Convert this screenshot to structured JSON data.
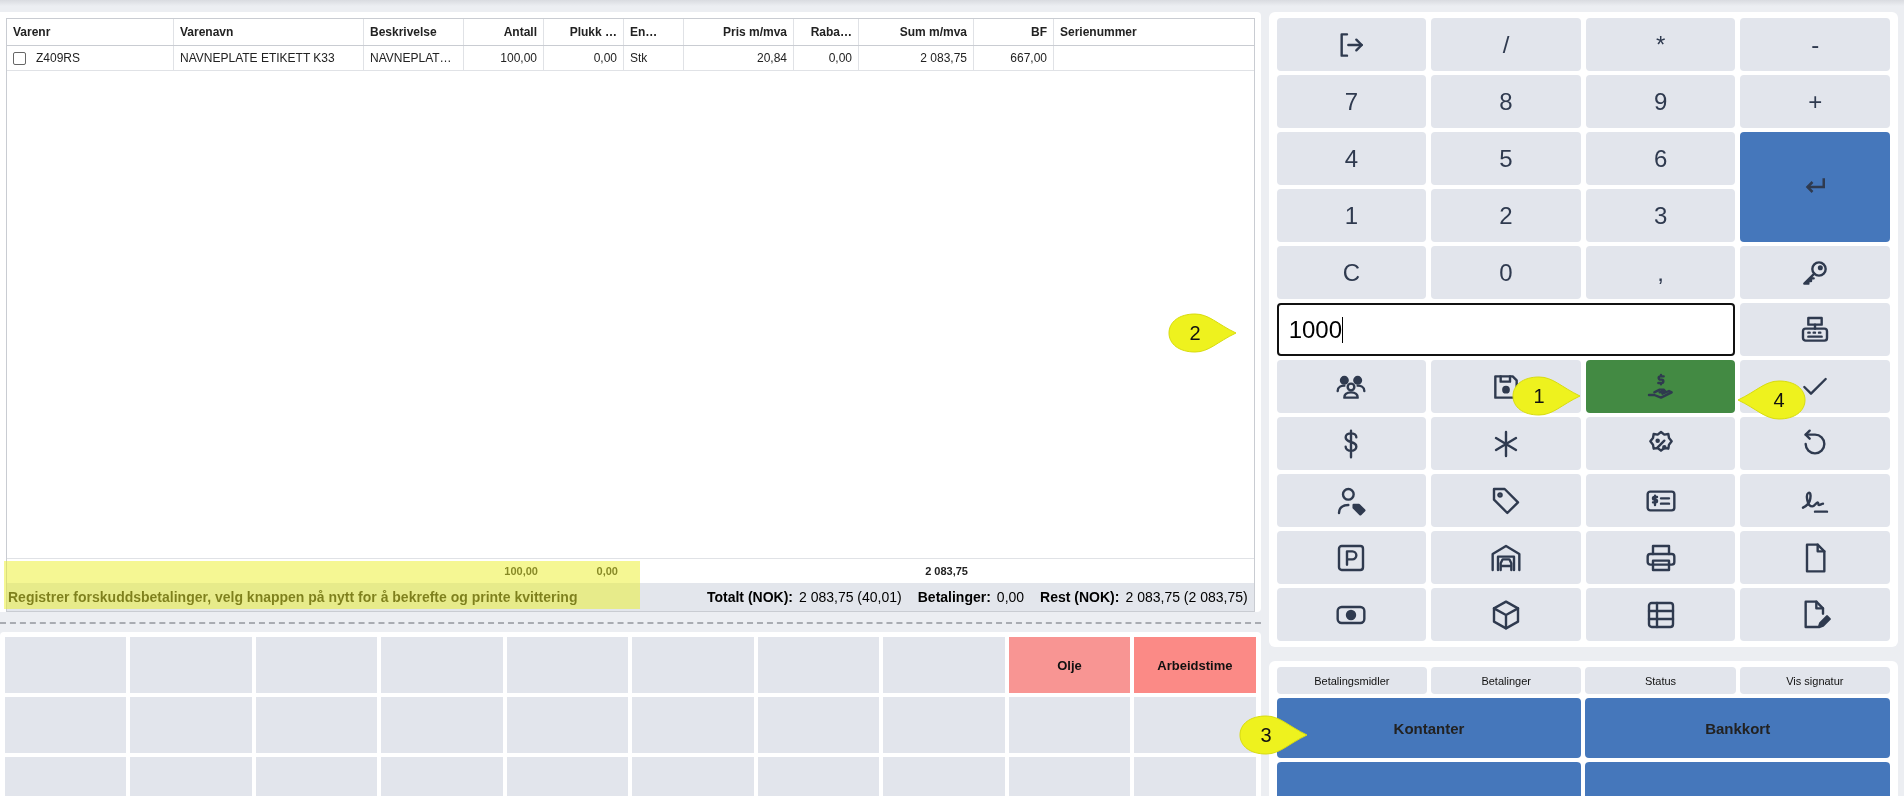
{
  "table": {
    "columns": [
      "Varenr",
      "Varenavn",
      "Beskrivelse",
      "Antall",
      "Plukk …",
      "En…",
      "Pris m/mva",
      "Raba…",
      "Sum m/mva",
      "BF",
      "Serienummer"
    ],
    "rows": [
      {
        "checked": false,
        "cells": [
          "Z409RS",
          "NAVNEPLATE ETIKETT K33",
          "NAVNEPLAT…",
          "100,00",
          "0,00",
          "Stk",
          "20,84",
          "0,00",
          "2 083,75",
          "667,00"
        ]
      }
    ],
    "totals": {
      "antall": "100,00",
      "plukk": "0,00",
      "sum": "2 083,75"
    }
  },
  "status_message": "Registrer forskuddsbetalinger, velg knappen på nytt for å bekrefte og printe kvittering",
  "summary": [
    {
      "label": "Totalt (NOK):",
      "value": "2 083,75 (40,01)"
    },
    {
      "label": "Betalinger:",
      "value": "0,00"
    },
    {
      "label": "Rest (NOK):",
      "value": "2 083,75 (2 083,75)"
    }
  ],
  "tiles": [
    {
      "kind": "blank"
    },
    {
      "kind": "blank"
    },
    {
      "kind": "blank"
    },
    {
      "kind": "blank"
    },
    {
      "kind": "blank"
    },
    {
      "kind": "blank"
    },
    {
      "kind": "blank"
    },
    {
      "kind": "blank"
    },
    {
      "kind": "item",
      "label": "Olje",
      "color": "#f89593"
    },
    {
      "kind": "item",
      "label": "Arbeidstime",
      "color": "#fb8a86"
    },
    {
      "kind": "blank"
    },
    {
      "kind": "blank"
    },
    {
      "kind": "blank"
    },
    {
      "kind": "blank"
    },
    {
      "kind": "blank"
    },
    {
      "kind": "blank"
    },
    {
      "kind": "blank"
    },
    {
      "kind": "blank"
    },
    {
      "kind": "blank"
    },
    {
      "kind": "blank"
    },
    {
      "kind": "blank"
    },
    {
      "kind": "blank"
    },
    {
      "kind": "blank"
    },
    {
      "kind": "blank"
    },
    {
      "kind": "blank"
    },
    {
      "kind": "blank"
    },
    {
      "kind": "blank"
    },
    {
      "kind": "blank"
    },
    {
      "kind": "blank"
    },
    {
      "kind": "blank"
    }
  ],
  "keypad": [
    {
      "kind": "icon",
      "active": false
    },
    {
      "kind": "key",
      "label": "/"
    },
    {
      "kind": "key",
      "label": "*"
    },
    {
      "kind": "key",
      "label": "-"
    },
    {
      "kind": "key",
      "label": "7"
    },
    {
      "kind": "key",
      "label": "8"
    },
    {
      "kind": "key",
      "label": "9"
    },
    {
      "kind": "key",
      "label": "+"
    },
    {
      "kind": "key",
      "label": "4"
    },
    {
      "kind": "key",
      "label": "5"
    },
    {
      "kind": "key",
      "label": "6"
    },
    {
      "kind": "enter"
    },
    {
      "kind": "key",
      "label": "1"
    },
    {
      "kind": "key",
      "label": "2"
    },
    {
      "kind": "key",
      "label": "3"
    },
    {
      "kind": "key",
      "label": "C"
    },
    {
      "kind": "key",
      "label": "0"
    },
    {
      "kind": "key",
      "label": ","
    },
    {
      "kind": "icon",
      "active": false
    },
    {
      "kind": "input",
      "value": "1000"
    },
    {
      "kind": "icon",
      "active": false
    },
    {
      "kind": "icon",
      "active": false
    },
    {
      "kind": "icon",
      "active": false
    },
    {
      "kind": "icon",
      "active": true
    },
    {
      "kind": "icon",
      "active": false
    },
    {
      "kind": "icon",
      "active": false
    },
    {
      "kind": "icon",
      "active": false
    },
    {
      "kind": "icon",
      "active": false
    },
    {
      "kind": "icon",
      "active": false
    },
    {
      "kind": "icon",
      "active": false
    },
    {
      "kind": "icon",
      "active": false
    },
    {
      "kind": "icon",
      "active": false
    },
    {
      "kind": "icon",
      "active": false
    },
    {
      "kind": "icon",
      "active": false
    },
    {
      "kind": "icon",
      "active": false
    },
    {
      "kind": "icon",
      "active": false
    },
    {
      "kind": "icon",
      "active": false
    },
    {
      "kind": "icon",
      "active": false
    },
    {
      "kind": "icon",
      "active": false
    },
    {
      "kind": "icon",
      "active": false
    },
    {
      "kind": "icon",
      "active": false
    }
  ],
  "payment_tabs": [
    "Betalingsmidler",
    "Betalinger",
    "Status",
    "Vis signatur"
  ],
  "payment_buttons": [
    {
      "kind": "labeled",
      "label": "Kontanter"
    },
    {
      "kind": "labeled",
      "label": "Bankkort"
    },
    {
      "kind": "blank"
    },
    {
      "kind": "blank"
    }
  ],
  "annotations": [
    {
      "kind": "highlight"
    },
    {
      "kind": "callout",
      "label": "2"
    },
    {
      "kind": "callout",
      "label": "1"
    },
    {
      "kind": "callout",
      "label": "4"
    },
    {
      "kind": "callout",
      "label": "3"
    }
  ]
}
